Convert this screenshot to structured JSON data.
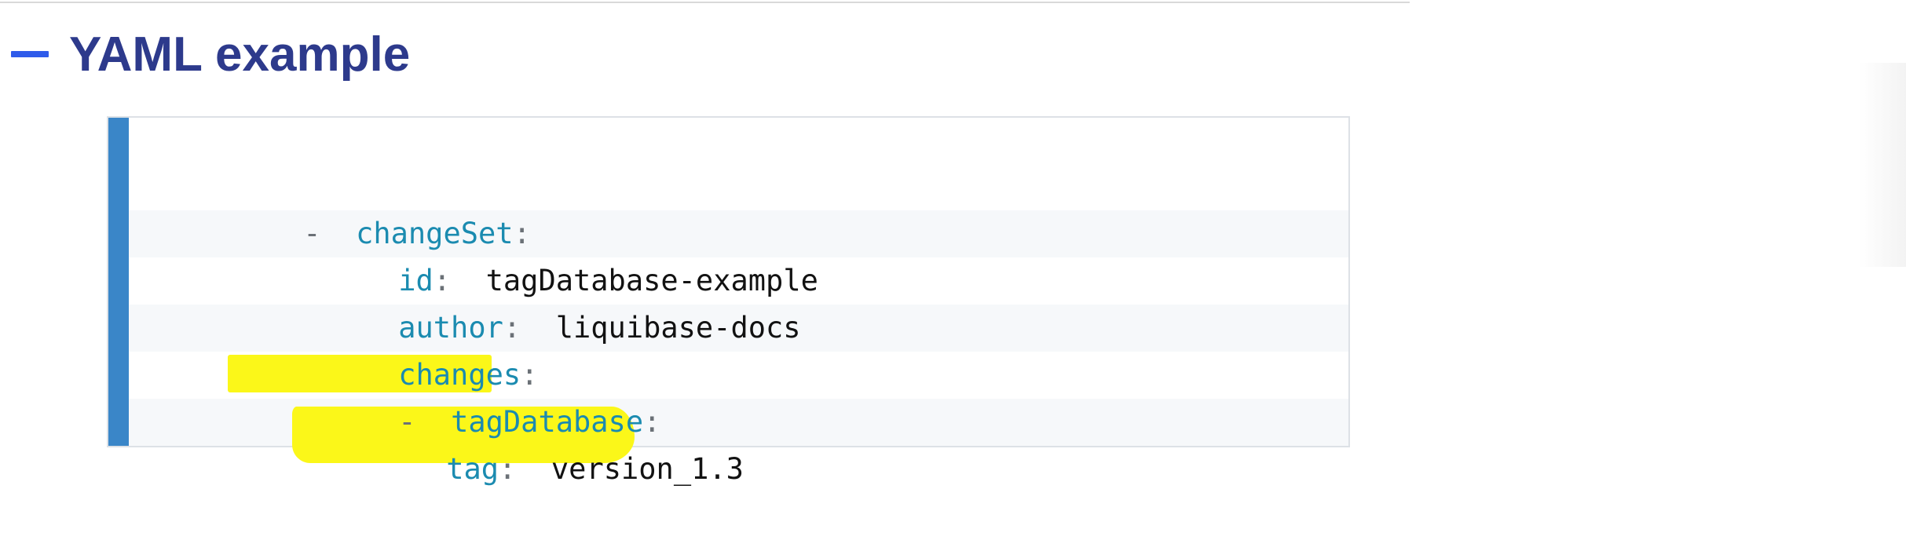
{
  "section": {
    "title": "YAML example"
  },
  "code": {
    "lines": [
      {
        "dash": "-",
        "key": "changeSet",
        "colon": ":",
        "value": ""
      },
      {
        "dash": "",
        "key": "id",
        "colon": ":",
        "value": "tagDatabase-example"
      },
      {
        "dash": "",
        "key": "author",
        "colon": ":",
        "value": "liquibase-docs"
      },
      {
        "dash": "",
        "key": "changes",
        "colon": ":",
        "value": ""
      },
      {
        "dash": "-",
        "key": "tagDatabase",
        "colon": ":",
        "value": ""
      },
      {
        "dash": "",
        "key": "tag",
        "colon": ":",
        "value": "version_1.3"
      }
    ]
  },
  "colors": {
    "heading": "#2d3a8c",
    "collapse_icon": "#2f5bea",
    "code_accent": "#3a86c8",
    "yaml_key": "#1b8bb0",
    "highlight": "#fbf719"
  },
  "icons": {
    "collapse": "minus-icon"
  }
}
